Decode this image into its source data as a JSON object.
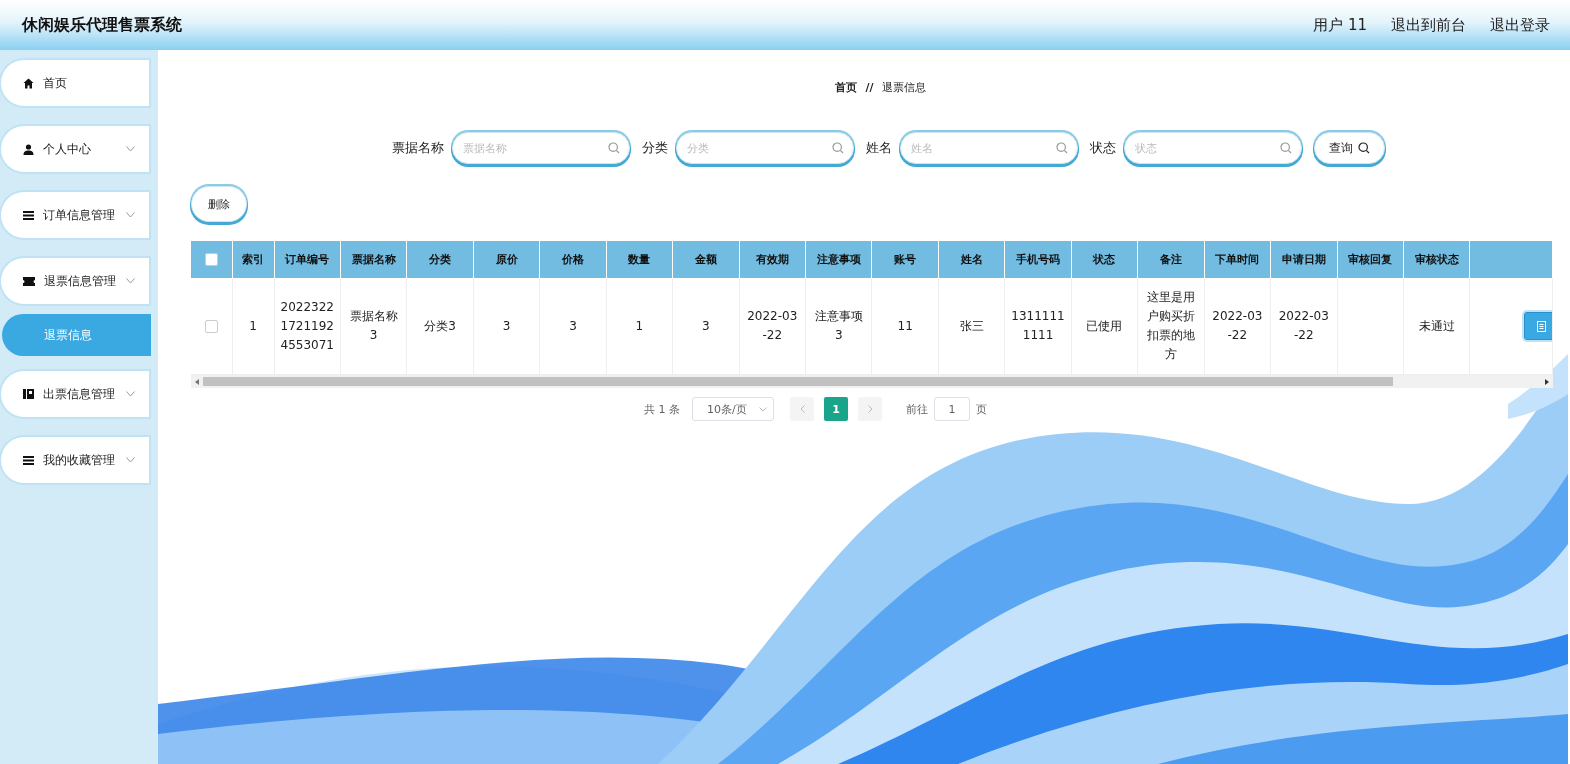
{
  "header": {
    "title": "休闲娱乐代理售票系统",
    "links": [
      "用户 11",
      "退出到前台",
      "退出登录"
    ]
  },
  "sidebar": {
    "items": [
      {
        "kind": "link",
        "label": "首页"
      },
      {
        "kind": "menu",
        "label": "个人中心"
      },
      {
        "kind": "menu",
        "label": "订单信息管理"
      },
      {
        "kind": "menu",
        "label": "退票信息管理",
        "children": [
          {
            "label": "退票信息",
            "selected": true
          }
        ]
      },
      {
        "kind": "menu",
        "label": "出票信息管理"
      },
      {
        "kind": "menu",
        "label": "我的收藏管理"
      }
    ]
  },
  "breadcrumb": {
    "items": [
      "首页",
      "退票信息"
    ],
    "separator": "//"
  },
  "search": {
    "fields": [
      {
        "label": "票据名称",
        "placeholder": "票据名称"
      },
      {
        "label": "分类",
        "placeholder": "分类"
      },
      {
        "label": "姓名",
        "placeholder": "姓名"
      },
      {
        "label": "状态",
        "placeholder": "状态"
      }
    ],
    "button": "查询"
  },
  "delete_button": "删除",
  "table": {
    "select_all_checked": false,
    "columns": [
      "索引",
      "订单编号",
      "票据名称",
      "分类",
      "原价",
      "价格",
      "数量",
      "金额",
      "有效期",
      "注意事项",
      "账号",
      "姓名",
      "手机号码",
      "状态",
      "备注",
      "下单时间",
      "申请日期",
      "审核回复",
      "审核状态"
    ],
    "rows": [
      {
        "checked": false,
        "cells": [
          "1",
          "202232217211924553071",
          "票据名称3",
          "分类3",
          "3",
          "3",
          "1",
          "3",
          "2022-03-22",
          "注意事项3",
          "11",
          "张三",
          "13111111111",
          "已使用",
          "这里是用户购买折扣票的地方",
          "2022-03-22",
          "2022-03-22",
          "",
          "未通过"
        ]
      }
    ]
  },
  "pagination": {
    "total": "共 1 条",
    "page_size": "10条/页",
    "pages": [
      {
        "label": "1",
        "selected": true
      }
    ],
    "goto_label": "前往",
    "goto_value": "1",
    "goto_suffix": "页"
  }
}
